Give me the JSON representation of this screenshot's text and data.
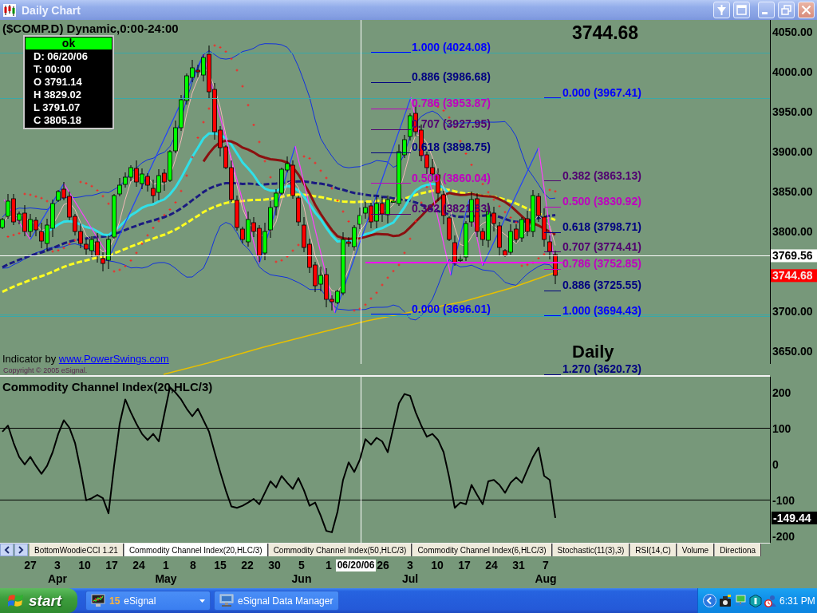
{
  "window": {
    "title": "Daily Chart"
  },
  "price_panel": {
    "header": "($COMP.D) Dynamic,0:00-24:00",
    "data_window": {
      "status": "ok",
      "rows": [
        "D: 06/20/06",
        "T: 00:00",
        "O 3791.14",
        "H 3829.02",
        "L 3791.07",
        "C 3805.18"
      ]
    },
    "last_price": "3744.68",
    "fib_sets": [
      {
        "levels": [
          {
            "label": "1.000 (4024.08)",
            "color": "#0000ff",
            "extended": true
          },
          {
            "label": "0.886 (3986.68)",
            "color": "#000080",
            "extended": false
          },
          {
            "label": "0.786 (3953.87)",
            "color": "#c000c0",
            "extended": false
          },
          {
            "label": "0.707 (3927.95)",
            "color": "#500070",
            "extended": false
          },
          {
            "label": "0.618 (3898.75)",
            "color": "#000080",
            "extended": false
          },
          {
            "label": "0.500 (3860.04)",
            "color": "#c000c0",
            "extended": false
          },
          {
            "label": "0.382 (3821.83)",
            "color": "#500070",
            "extended": false
          },
          {
            "label": "0.000 (3696.01)",
            "color": "#0000ff",
            "extended": true
          }
        ]
      },
      {
        "levels": [
          {
            "label": "0.000 (3967.41)",
            "color": "#0000ff",
            "extended": true
          },
          {
            "label": "0.382 (3863.13)",
            "color": "#500070",
            "extended": false
          },
          {
            "label": "0.500 (3830.92)",
            "color": "#c000c0",
            "extended": false
          },
          {
            "label": "0.618 (3798.71)",
            "color": "#000080",
            "extended": false
          },
          {
            "label": "0.707 (3774.41)",
            "color": "#500070",
            "extended": false
          },
          {
            "label": "0.786 (3752.85)",
            "color": "#c000c0",
            "extended": false
          },
          {
            "label": "0.886 (3725.55)",
            "color": "#000080",
            "extended": false
          },
          {
            "label": "1.000 (3694.43)",
            "color": "#0000ff",
            "extended": true
          },
          {
            "label": "1.270 (3620.73)",
            "color": "#000080",
            "extended": false
          }
        ]
      }
    ],
    "timeframe": "Daily",
    "credit": "Indicator by",
    "credit_link": "www.PowerSwings.com",
    "copyright": "Copyright © 2005 eSignal.",
    "axis_labels": [
      "4050.00",
      "4000.00",
      "3950.00",
      "3900.00",
      "3850.00",
      "3800.00",
      "3700.00",
      "3650.00"
    ],
    "crosshair_tag": "3769.56",
    "last_price_tag": "3744.68"
  },
  "cci_panel": {
    "chart_data": {
      "type": "line",
      "title": "Commodity Channel Index(20,HLC/3)",
      "ylim": [
        -218,
        244
      ],
      "yticks": [
        200,
        100,
        0,
        -100,
        -200
      ],
      "series": [
        {
          "color": "#000000",
          "values": [
            91,
            108,
            60,
            21,
            0,
            21,
            -4,
            -26,
            -4,
            34,
            85,
            123,
            102,
            60,
            -15,
            -100,
            -94,
            -85,
            -94,
            -136,
            -4,
            113,
            181,
            145,
            113,
            85,
            68,
            85,
            64,
            140,
            215,
            200,
            181,
            155,
            134,
            155,
            123,
            91,
            34,
            -21,
            -72,
            -117,
            -121,
            -115,
            -106,
            -96,
            -111,
            -79,
            -47,
            -64,
            -32,
            -51,
            -68,
            -38,
            -72,
            -115,
            -106,
            -143,
            -185,
            -189,
            -132,
            -43,
            6,
            -21,
            13,
            70,
            55,
            74,
            64,
            34,
            102,
            170,
            196,
            191,
            145,
            108,
            77,
            85,
            68,
            34,
            -36,
            -121,
            -106,
            -111,
            -57,
            -85,
            -111,
            -47,
            -43,
            -57,
            -79,
            -51,
            -36,
            -51,
            -15,
            21,
            47,
            -32,
            -43,
            -149
          ]
        }
      ]
    },
    "last_value_tag": "-149.44"
  },
  "indicator_tabs": [
    {
      "label": "BottomWoodieCCI 1.21",
      "selected": false
    },
    {
      "label": "Commodity Channel Index(20,HLC/3)",
      "selected": true
    },
    {
      "label": "Commodity Channel Index(50,HLC/3)",
      "selected": false
    },
    {
      "label": "Commodity Channel Index(6,HLC/3)",
      "selected": false
    },
    {
      "label": "Stochastic(11(3),3)",
      "selected": false
    },
    {
      "label": "RSI(14,C)",
      "selected": false
    },
    {
      "label": "Volume",
      "selected": false
    },
    {
      "label": "Directiona",
      "selected": false
    }
  ],
  "time_axis": {
    "ticks": [
      {
        "kind": "day",
        "label": "27"
      },
      {
        "kind": "day",
        "label": "3",
        "month": "Apr"
      },
      {
        "kind": "day",
        "label": "10"
      },
      {
        "kind": "day",
        "label": "17"
      },
      {
        "kind": "day",
        "label": "24"
      },
      {
        "kind": "day",
        "label": "1",
        "month": "May"
      },
      {
        "kind": "day",
        "label": "8"
      },
      {
        "kind": "day",
        "label": "15"
      },
      {
        "kind": "day",
        "label": "22"
      },
      {
        "kind": "day",
        "label": "30"
      },
      {
        "kind": "day",
        "label": "5",
        "month": "Jun"
      },
      {
        "kind": "day",
        "label": "1"
      },
      {
        "kind": "cursor",
        "label": "06/20/06"
      },
      {
        "kind": "day",
        "label": "26"
      },
      {
        "kind": "day",
        "label": "3",
        "month": "Jul"
      },
      {
        "kind": "day",
        "label": "10"
      },
      {
        "kind": "day",
        "label": "17"
      },
      {
        "kind": "day",
        "label": "24"
      },
      {
        "kind": "day",
        "label": "31"
      },
      {
        "kind": "day",
        "label": "7",
        "month": "Aug"
      }
    ]
  },
  "taskbar": {
    "start": "start",
    "tasks": [
      {
        "kind": "group",
        "count": "15",
        "label": "eSignal"
      },
      {
        "kind": "window",
        "label": "eSignal Data Manager"
      }
    ],
    "clock": "6:31 PM"
  }
}
